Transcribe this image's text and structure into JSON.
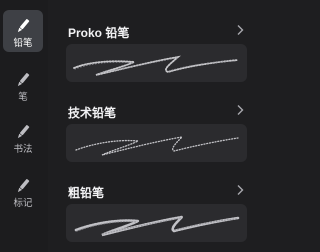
{
  "sidebar": {
    "items": [
      {
        "label": "铅笔",
        "icon": "pencil-icon",
        "active": true
      },
      {
        "label": "笔",
        "icon": "pencil-icon",
        "active": false
      },
      {
        "label": "书法",
        "icon": "pencil-icon",
        "active": false
      },
      {
        "label": "标记",
        "icon": "pencil-icon",
        "active": false
      }
    ]
  },
  "brushes": [
    {
      "title": "Proko 铅笔",
      "icon": "chevron-right-icon"
    },
    {
      "title": "技术铅笔",
      "icon": "chevron-right-icon"
    },
    {
      "title": "粗铅笔",
      "icon": "chevron-right-icon"
    }
  ],
  "colors": {
    "background": "#1e1e20",
    "active_tab": "#3e4045",
    "preview_bg": "#2b2b2e",
    "stroke": "#d8d8dc"
  }
}
